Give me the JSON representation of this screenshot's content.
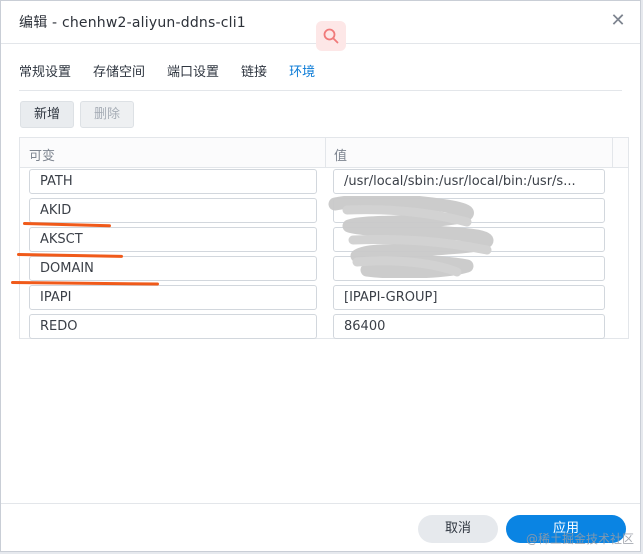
{
  "window": {
    "title": "编辑 - chenhw2-aliyun-ddns-cli1"
  },
  "tabs": [
    {
      "label": "常规设置",
      "active": false
    },
    {
      "label": "存储空间",
      "active": false
    },
    {
      "label": "端口设置",
      "active": false
    },
    {
      "label": "链接",
      "active": false
    },
    {
      "label": "环境",
      "active": true
    }
  ],
  "toolbar": {
    "add_label": "新增",
    "delete_label": "删除"
  },
  "table": {
    "headers": [
      "可变",
      "值"
    ],
    "rows": [
      {
        "name": "PATH",
        "value": "/usr/local/sbin:/usr/local/bin:/usr/s..."
      },
      {
        "name": "AKID",
        "value": ""
      },
      {
        "name": "AKSCT",
        "value": ""
      },
      {
        "name": "DOMAIN",
        "value": ""
      },
      {
        "name": "IPAPI",
        "value": "[IPAPI-GROUP]"
      },
      {
        "name": "REDO",
        "value": "86400"
      }
    ]
  },
  "footer": {
    "cancel_label": "取消",
    "apply_label": "应用"
  },
  "watermark": "@稀土掘金技术社区",
  "colors": {
    "accent": "#0a84e3",
    "active_tab": "#0a7ad6",
    "annotation_underline": "#f05a1a"
  },
  "icons": [
    "close-icon",
    "search-icon"
  ]
}
